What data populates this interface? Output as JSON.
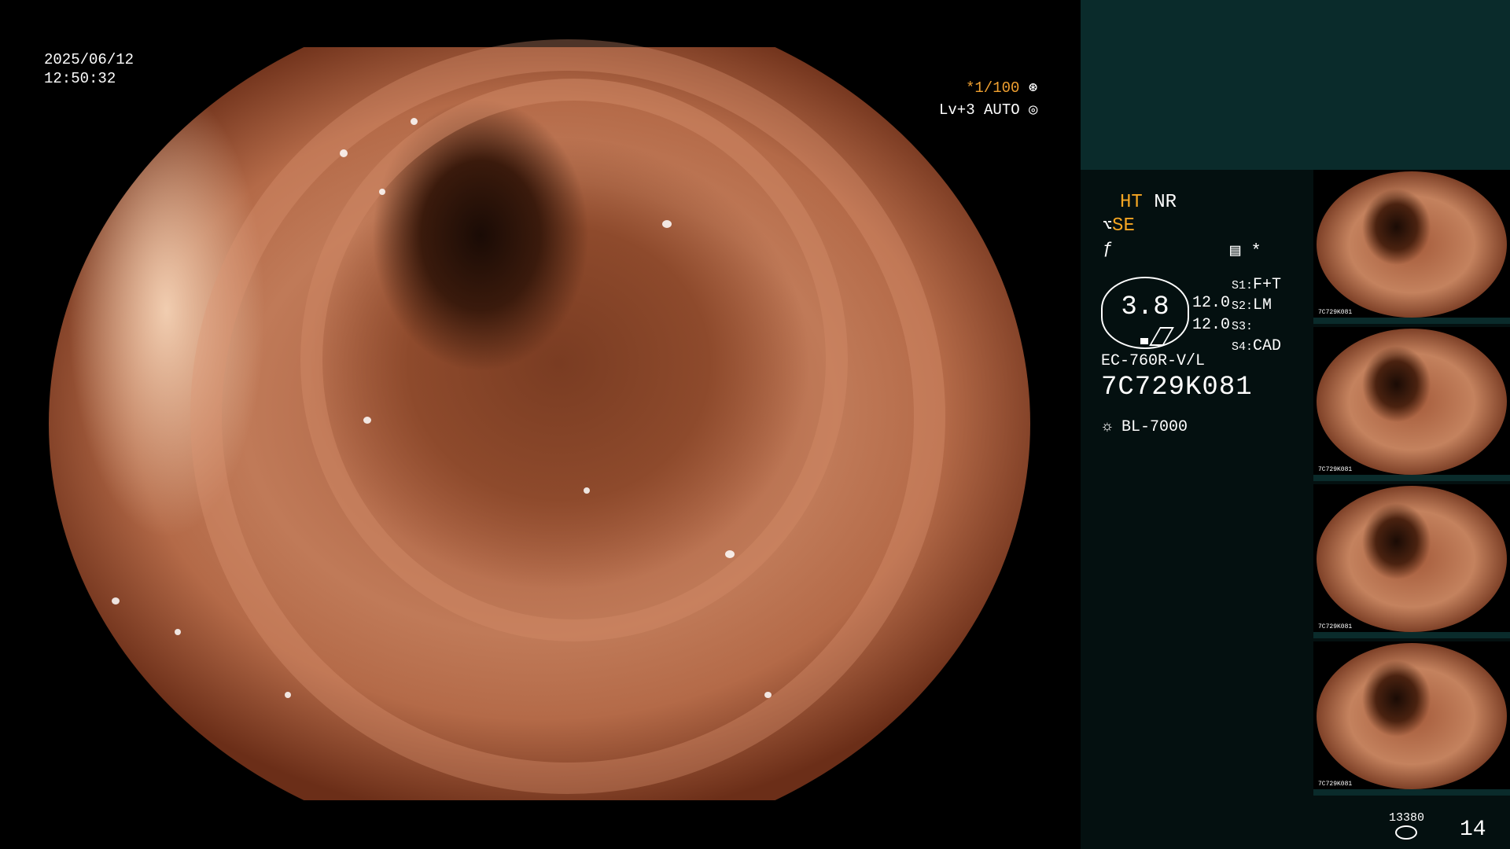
{
  "endoscope_view": {
    "description_icon": "endoscopic-lumen-image"
  },
  "timestamp": {
    "date": "2025/06/12",
    "time": "12:50:32"
  },
  "top_right": {
    "shutter": "*1/100",
    "shutter_icon": "shutter-icon",
    "level": "Lv+3",
    "iris": "AUTO",
    "iris_icon": "iris-icon"
  },
  "panel": {
    "ht": "HT",
    "nr": "NR",
    "se_icon": "enhancement-icon",
    "se": "SE",
    "f_icon": "f-icon",
    "icon1": "settings-panel-icon",
    "icon2": "*",
    "oval_value": "3.8",
    "value1": "12.0",
    "value2": "12.0",
    "slots": [
      {
        "key": "S1:",
        "value": "F+T"
      },
      {
        "key": "S2:",
        "value": "LM"
      },
      {
        "key": "S3:",
        "value": ""
      },
      {
        "key": "S4:",
        "value": "CAD"
      }
    ],
    "model": "EC-760R-V/L",
    "serial": "7C729K081",
    "light_icon": "sun-icon",
    "light_source": "BL-7000"
  },
  "thumbnails": [
    {
      "caption": "7C729K081"
    },
    {
      "caption": "7C729K081"
    },
    {
      "caption": "7C729K081"
    },
    {
      "caption": "7C729K081"
    }
  ],
  "counter": {
    "small": "13380",
    "big": "14",
    "icon": "storage-icon"
  }
}
